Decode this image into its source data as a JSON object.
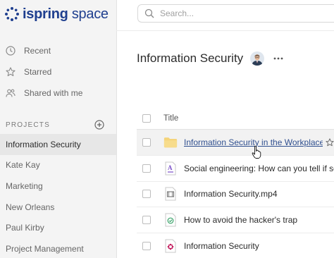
{
  "logo": {
    "word1": "ispring",
    "word2": "space"
  },
  "search": {
    "placeholder": "Search..."
  },
  "nav": [
    {
      "label": "Recent",
      "icon": "clock-icon"
    },
    {
      "label": "Starred",
      "icon": "star-icon"
    },
    {
      "label": "Shared with me",
      "icon": "users-icon"
    }
  ],
  "projects": {
    "title": "PROJECTS",
    "items": [
      {
        "label": "Information Security",
        "active": true
      },
      {
        "label": "Kate Kay"
      },
      {
        "label": "Marketing"
      },
      {
        "label": "New Orleans"
      },
      {
        "label": "Paul Kirby"
      },
      {
        "label": "Project Management"
      }
    ]
  },
  "main": {
    "title": "Information Security",
    "table": {
      "header": "Title",
      "rows": [
        {
          "name": "Information Security in the Workplace",
          "icon": "folder-icon"
        },
        {
          "name": "Social engineering: How can you tell if someone is trying to trick you",
          "icon": "text-document-icon"
        },
        {
          "name": "Information Security.mp4",
          "icon": "video-file-icon"
        },
        {
          "name": "How to avoid the hacker's trap",
          "icon": "quiz-icon"
        },
        {
          "name": "Information Security",
          "icon": "course-icon"
        }
      ]
    }
  },
  "colors": {
    "brand": "#1f3f8f",
    "link": "#2f4f8f",
    "folder": "#f5d47a",
    "quiz": "#3aa36a",
    "course": "#c2185b",
    "text_doc": "#7b4fc9"
  }
}
